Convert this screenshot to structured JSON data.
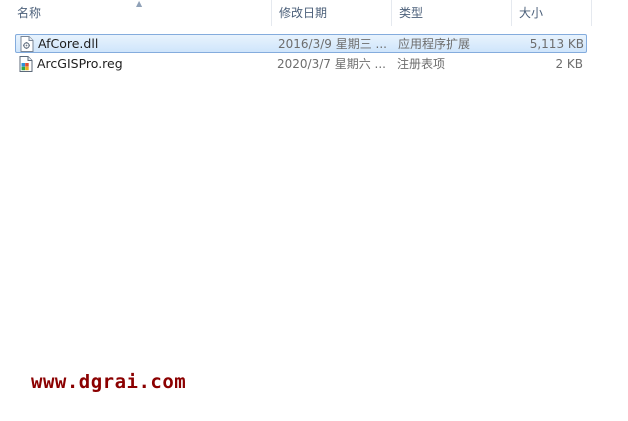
{
  "columns": {
    "name": "名称",
    "modified": "修改日期",
    "type": "类型",
    "size": "大小"
  },
  "files": [
    {
      "name": "AfCore.dll",
      "modified": "2016/3/9 星期三 ...",
      "type": "应用程序扩展",
      "size": "5,113 KB",
      "icon": "dll-file-icon",
      "selected": true
    },
    {
      "name": "ArcGISPro.reg",
      "modified": "2020/3/7 星期六 ...",
      "type": "注册表项",
      "size": "2 KB",
      "icon": "registry-file-icon",
      "selected": false
    }
  ],
  "watermark": "www.dgrai.com",
  "colors": {
    "header_text": "#4c607a",
    "selection_border": "#84acdd",
    "selection_fill": "#cfe5fb",
    "watermark": "#8b0000"
  }
}
